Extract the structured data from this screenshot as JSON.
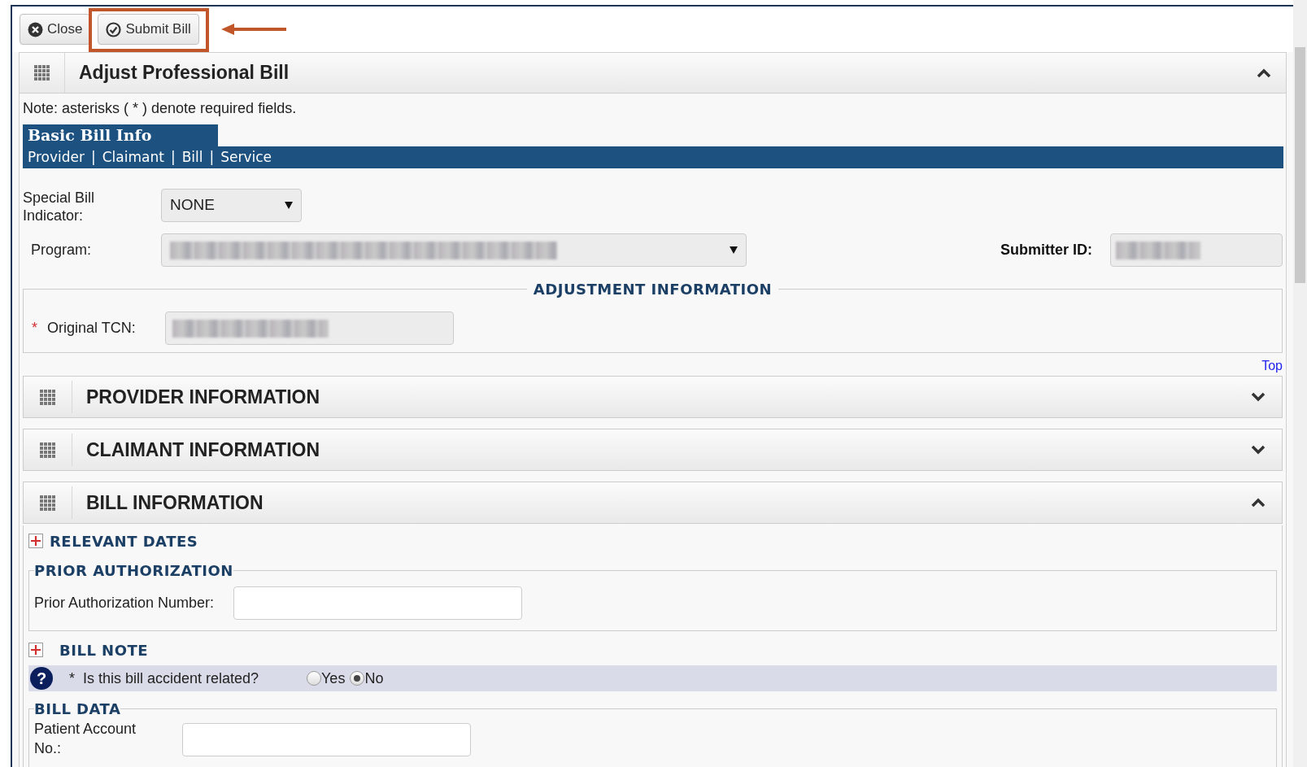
{
  "toolbar": {
    "buttons": [
      {
        "label": "Close",
        "kind": "close",
        "highlighted": false
      },
      {
        "label": "Submit Bill",
        "kind": "submit",
        "highlighted": true
      }
    ]
  },
  "panel": {
    "title": "Adjust Professional Bill",
    "expanded": true
  },
  "note": "Note: asterisks ( * ) denote required fields.",
  "nav": {
    "title": "Basic Bill Info",
    "items": [
      {
        "kind": "link",
        "text": "Provider"
      },
      {
        "kind": "separator",
        "text": "|"
      },
      {
        "kind": "link",
        "text": "Claimant"
      },
      {
        "kind": "separator",
        "text": "|"
      },
      {
        "kind": "link",
        "text": "Bill"
      },
      {
        "kind": "separator",
        "text": "|"
      },
      {
        "kind": "link",
        "text": "Service"
      }
    ]
  },
  "special_bill_indicator": {
    "label": "Special Bill Indicator:",
    "value": "NONE"
  },
  "program": {
    "label": "Program:"
  },
  "submitter_id": {
    "label": "Submitter ID:"
  },
  "adjustment": {
    "legend": "ADJUSTMENT INFORMATION",
    "label": "Original TCN:",
    "required_mark": "*"
  },
  "top_link": "Top",
  "sections": [
    {
      "title": "PROVIDER INFORMATION",
      "expanded": false
    },
    {
      "title": "CLAIMANT INFORMATION",
      "expanded": false
    },
    {
      "title": "BILL INFORMATION",
      "expanded": true
    }
  ],
  "relevant_dates": {
    "title": "RELEVANT DATES",
    "expanded": false
  },
  "prior_authorization": {
    "legend": "PRIOR AUTHORIZATION",
    "label": "Prior Authorization Number:"
  },
  "bill_note": {
    "title": "BILL NOTE",
    "expanded": false
  },
  "accident": {
    "help": "?",
    "required_mark": "*",
    "question": "Is this bill accident related?",
    "options": [
      {
        "label": "Yes",
        "selected": false
      },
      {
        "label": "No",
        "selected": true
      }
    ]
  },
  "bill_data": {
    "legend": "BILL DATA",
    "label": "Patient Account No.:"
  }
}
